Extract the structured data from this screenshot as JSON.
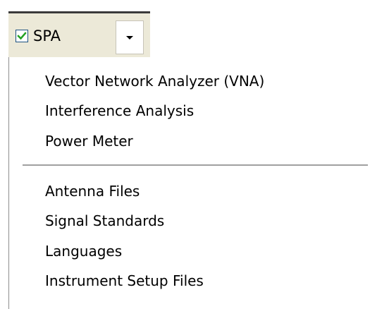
{
  "toolbar": {
    "mode_label": "SPA",
    "mode_checked": true
  },
  "menu": {
    "group1": [
      {
        "label": "Vector Network Analyzer (VNA)"
      },
      {
        "label": "Interference Analysis"
      },
      {
        "label": "Power Meter"
      }
    ],
    "group2": [
      {
        "label": "Antenna Files"
      },
      {
        "label": "Signal Standards"
      },
      {
        "label": "Languages"
      },
      {
        "label": "Instrument Setup Files"
      }
    ]
  },
  "colors": {
    "toolbar_bg": "#ece9d8",
    "check_green": "#21a121",
    "menu_bg": "#ffffff"
  }
}
